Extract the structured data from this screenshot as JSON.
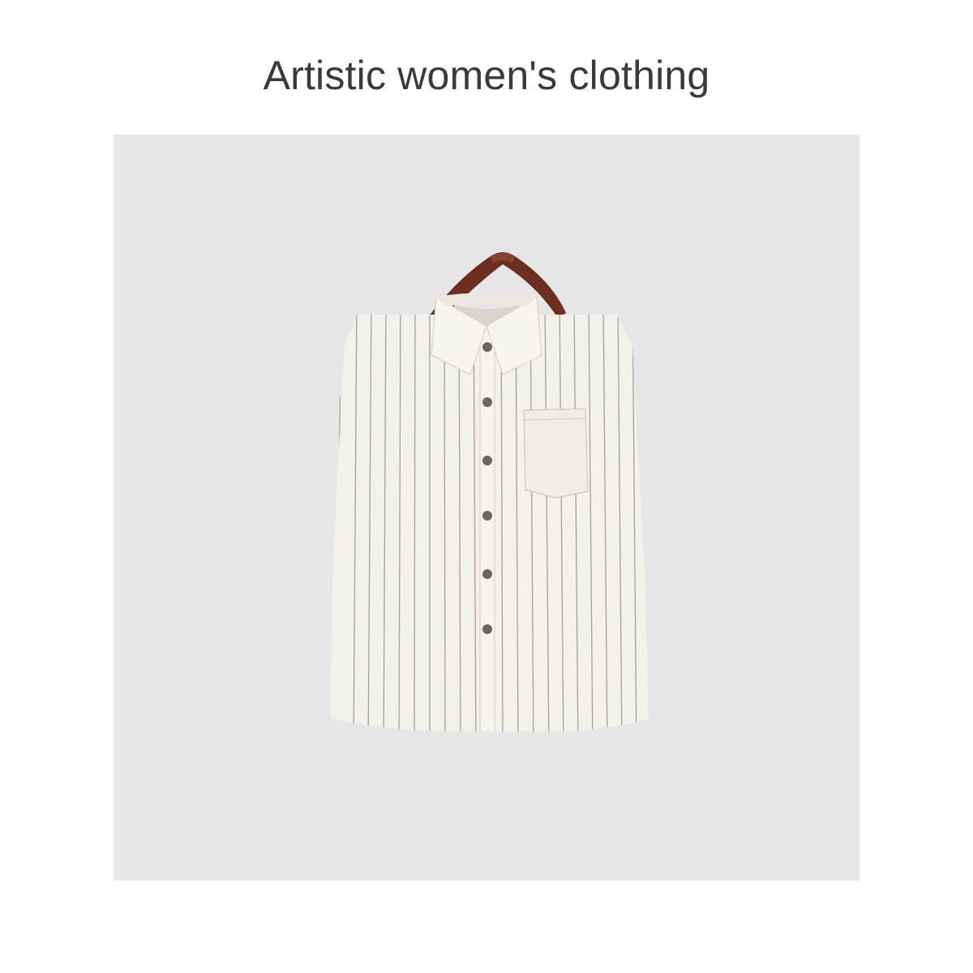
{
  "header": {
    "title": "Artistic women's clothing"
  },
  "product_photo": {
    "subject": "white-striped-shirt-on-hanger",
    "background_color": "#e6e6e7",
    "shirt_color": "#f3f0e9",
    "stripe_color": "#8b8780",
    "hanger_color": "#6b2e1f",
    "button_color": "#6a6660"
  }
}
